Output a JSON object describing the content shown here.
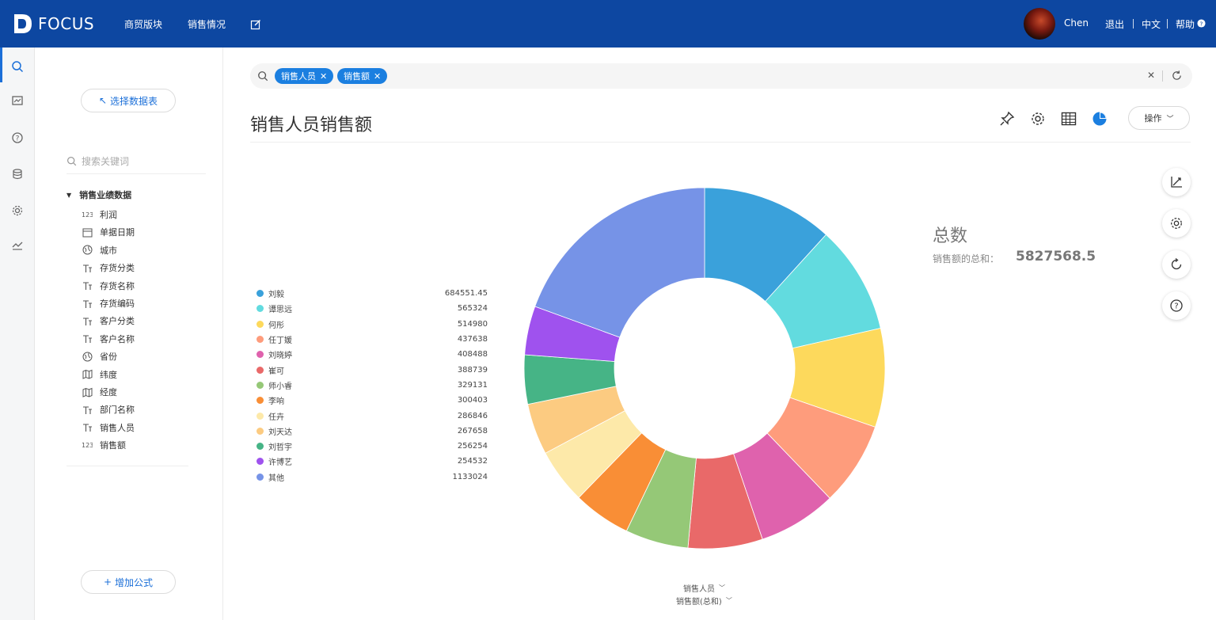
{
  "app": {
    "name": "FOCUS"
  },
  "nav": {
    "items": [
      "商贸版块",
      "销售情况"
    ]
  },
  "user": {
    "name": "Chen",
    "logout": "退出",
    "lang": "中文",
    "help": "帮助"
  },
  "datapanel": {
    "select_table": "选择数据表",
    "search_placeholder": "搜索关键词",
    "group": "销售业绩数据",
    "fields": [
      {
        "label": "利润",
        "icon": "number-icon"
      },
      {
        "label": "单据日期",
        "icon": "calendar-icon"
      },
      {
        "label": "城市",
        "icon": "globe-icon"
      },
      {
        "label": "存货分类",
        "icon": "text-icon"
      },
      {
        "label": "存货名称",
        "icon": "text-icon"
      },
      {
        "label": "存货编码",
        "icon": "text-icon"
      },
      {
        "label": "客户分类",
        "icon": "text-icon"
      },
      {
        "label": "客户名称",
        "icon": "text-icon"
      },
      {
        "label": "省份",
        "icon": "globe-icon"
      },
      {
        "label": "纬度",
        "icon": "map-icon"
      },
      {
        "label": "经度",
        "icon": "map-icon"
      },
      {
        "label": "部门名称",
        "icon": "text-icon"
      },
      {
        "label": "销售人员",
        "icon": "text-icon"
      },
      {
        "label": "销售额",
        "icon": "number-icon"
      }
    ],
    "add_formula": "增加公式"
  },
  "search": {
    "chips": [
      "销售人员",
      "销售额"
    ]
  },
  "page": {
    "title": "销售人员销售额",
    "operate": "操作"
  },
  "summary": {
    "title": "总数",
    "label": "销售额的总和：",
    "value": "5827568.5"
  },
  "axis": {
    "dimension": "销售人员",
    "measure": "销售额(总和)"
  },
  "chart_data": {
    "type": "pie",
    "categories": [
      "刘毅",
      "谭思远",
      "何彤",
      "任丁媛",
      "刘晓婷",
      "崔可",
      "师小睿",
      "李响",
      "任卉",
      "刘天达",
      "刘哲宇",
      "许博艺",
      "其他"
    ],
    "values": [
      684551.45,
      565324,
      514980,
      437638,
      408488,
      388739,
      329131,
      300403,
      286846,
      267658,
      256254,
      254532,
      1133024
    ],
    "value_labels": [
      "684551.45",
      "565324",
      "514980",
      "437638",
      "408488",
      "388739",
      "329131",
      "300403",
      "286846",
      "267658",
      "256254",
      "254532",
      "1133024"
    ],
    "colors": [
      "#3aa1db",
      "#62dbdf",
      "#fdd95c",
      "#fe9c7c",
      "#df62ad",
      "#e96969",
      "#95c877",
      "#f98e36",
      "#fde9a9",
      "#fccb81",
      "#46b486",
      "#9f52ee",
      "#7693e7"
    ],
    "legend_position": "left"
  }
}
